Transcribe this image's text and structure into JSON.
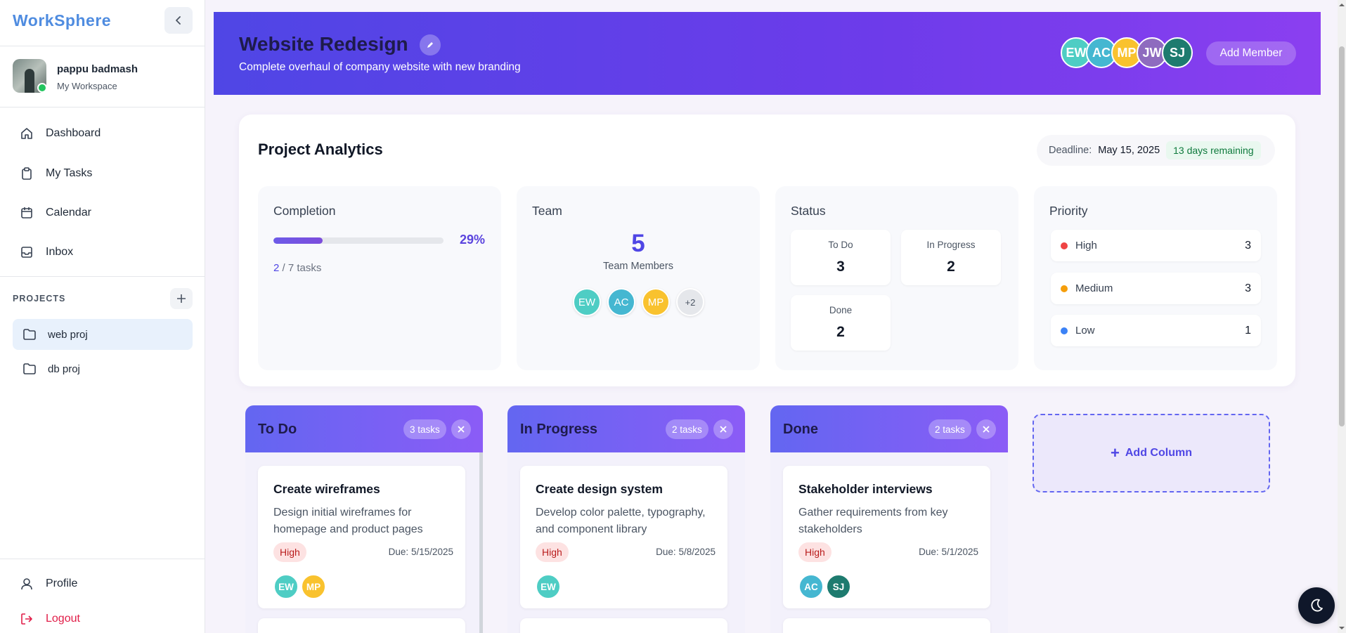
{
  "app": {
    "brand": "WorkSphere"
  },
  "user": {
    "name": "pappu badmash",
    "workspace": "My Workspace"
  },
  "nav": [
    {
      "label": "Dashboard",
      "icon": "home-icon"
    },
    {
      "label": "My Tasks",
      "icon": "clipboard-icon"
    },
    {
      "label": "Calendar",
      "icon": "calendar-icon"
    },
    {
      "label": "Inbox",
      "icon": "inbox-icon"
    }
  ],
  "projects": {
    "label": "PROJECTS",
    "items": [
      {
        "label": "web proj",
        "active": true
      },
      {
        "label": "db proj",
        "active": false
      }
    ]
  },
  "footer_nav": {
    "profile": "Profile",
    "logout": "Logout"
  },
  "project": {
    "title": "Website Redesign",
    "description": "Complete overhaul of company website with new branding",
    "members": [
      {
        "initials": "EW",
        "color": "#4ecdc4"
      },
      {
        "initials": "AC",
        "color": "#45b7d1"
      },
      {
        "initials": "MP",
        "color": "#f9c22e"
      },
      {
        "initials": "JW",
        "color": "#8e6bbf"
      },
      {
        "initials": "SJ",
        "color": "#1e7b6f"
      }
    ],
    "add_member_label": "Add Member"
  },
  "analytics": {
    "title": "Project Analytics",
    "deadline_label": "Deadline:",
    "deadline_date": "May 15, 2025",
    "remaining": "13 days remaining",
    "completion": {
      "title": "Completion",
      "percent": 29,
      "percent_label": "29%",
      "done": "2",
      "total_text": "/ 7 tasks"
    },
    "team": {
      "title": "Team",
      "count": "5",
      "label": "Team Members",
      "avatars": [
        {
          "initials": "EW",
          "color": "#4ecdc4"
        },
        {
          "initials": "AC",
          "color": "#45b7d1"
        },
        {
          "initials": "MP",
          "color": "#f9c22e"
        },
        {
          "initials": "+2",
          "color": "#e5e7eb"
        }
      ]
    },
    "status": {
      "title": "Status",
      "items": [
        {
          "label": "To Do",
          "count": "3"
        },
        {
          "label": "In Progress",
          "count": "2"
        },
        {
          "label": "Done",
          "count": "2"
        }
      ]
    },
    "priority": {
      "title": "Priority",
      "items": [
        {
          "label": "High",
          "count": "3",
          "color": "#ef4444"
        },
        {
          "label": "Medium",
          "count": "3",
          "color": "#f59e0b"
        },
        {
          "label": "Low",
          "count": "1",
          "color": "#3b82f6"
        }
      ]
    }
  },
  "columns": [
    {
      "title": "To Do",
      "count": "3 tasks",
      "card": {
        "title": "Create wireframes",
        "description": "Design initial wireframes for homepage and product pages",
        "priority": "High",
        "due": "Due: 5/15/2025",
        "assignees": [
          {
            "initials": "EW",
            "color": "#4ecdc4"
          },
          {
            "initials": "MP",
            "color": "#f9c22e"
          }
        ]
      }
    },
    {
      "title": "In Progress",
      "count": "2 tasks",
      "card": {
        "title": "Create design system",
        "description": "Develop color palette, typography, and component library",
        "priority": "High",
        "due": "Due: 5/8/2025",
        "assignees": [
          {
            "initials": "EW",
            "color": "#4ecdc4"
          }
        ]
      }
    },
    {
      "title": "Done",
      "count": "2 tasks",
      "card": {
        "title": "Stakeholder interviews",
        "description": "Gather requirements from key stakeholders",
        "priority": "High",
        "due": "Due: 5/1/2025",
        "assignees": [
          {
            "initials": "AC",
            "color": "#45b7d1"
          },
          {
            "initials": "SJ",
            "color": "#1e7b6f"
          }
        ]
      }
    }
  ],
  "add_column_label": "Add Column"
}
